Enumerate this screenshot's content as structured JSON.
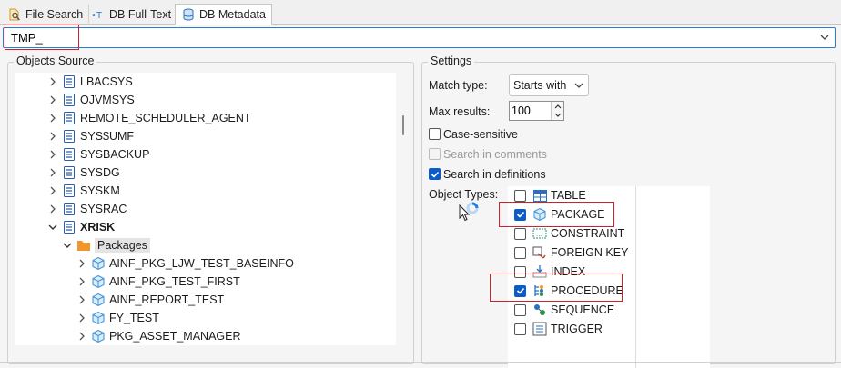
{
  "tabs": [
    {
      "label": "File Search",
      "icon": "file-search-icon"
    },
    {
      "label": "DB Full-Text",
      "icon": "fulltext-icon"
    },
    {
      "label": "DB Metadata",
      "icon": "database-icon",
      "active": true
    }
  ],
  "search": {
    "value": "TMP_"
  },
  "objects_source": {
    "title": "Objects Source",
    "items": [
      {
        "label": "LBACSYS",
        "expanded": false,
        "level": 1,
        "icon": "schema-icon"
      },
      {
        "label": "OJVMSYS",
        "expanded": false,
        "level": 1,
        "icon": "schema-icon"
      },
      {
        "label": "REMOTE_SCHEDULER_AGENT",
        "expanded": false,
        "level": 1,
        "icon": "schema-icon"
      },
      {
        "label": "SYS$UMF",
        "expanded": false,
        "level": 1,
        "icon": "schema-icon"
      },
      {
        "label": "SYSBACKUP",
        "expanded": false,
        "level": 1,
        "icon": "schema-icon"
      },
      {
        "label": "SYSDG",
        "expanded": false,
        "level": 1,
        "icon": "schema-icon"
      },
      {
        "label": "SYSKM",
        "expanded": false,
        "level": 1,
        "icon": "schema-icon"
      },
      {
        "label": "SYSRAC",
        "expanded": false,
        "level": 1,
        "icon": "schema-icon"
      },
      {
        "label": "XRISK",
        "expanded": true,
        "level": 1,
        "icon": "schema-icon",
        "bold": true
      },
      {
        "label": "Packages",
        "expanded": true,
        "level": 2,
        "icon": "folder-icon",
        "selected": true
      },
      {
        "label": "AINF_PKG_LJW_TEST_BASEINFO",
        "expanded": false,
        "level": 3,
        "icon": "package-icon"
      },
      {
        "label": "AINF_PKG_TEST_FIRST",
        "expanded": false,
        "level": 3,
        "icon": "package-icon"
      },
      {
        "label": "AINF_REPORT_TEST",
        "expanded": false,
        "level": 3,
        "icon": "package-icon"
      },
      {
        "label": "FY_TEST",
        "expanded": false,
        "level": 3,
        "icon": "package-icon"
      },
      {
        "label": "PKG_ASSET_MANAGER",
        "expanded": false,
        "level": 3,
        "icon": "package-icon"
      }
    ]
  },
  "settings": {
    "title": "Settings",
    "match_type_label": "Match type:",
    "match_type_value": "Starts with",
    "max_results_label": "Max results:",
    "max_results_value": "100",
    "case_sensitive": {
      "label": "Case-sensitive",
      "checked": false
    },
    "search_comments": {
      "label": "Search in comments",
      "checked": false,
      "disabled": true
    },
    "search_definitions": {
      "label": "Search in definitions",
      "checked": true
    },
    "object_types_label": "Object Types:",
    "object_types": [
      {
        "label": "TABLE",
        "checked": false,
        "icon": "table-icon"
      },
      {
        "label": "PACKAGE",
        "checked": true,
        "icon": "package-icon"
      },
      {
        "label": "CONSTRAINT",
        "checked": false,
        "icon": "constraint-icon"
      },
      {
        "label": "FOREIGN KEY",
        "checked": false,
        "icon": "foreign-key-icon"
      },
      {
        "label": "INDEX",
        "checked": false,
        "icon": "index-icon"
      },
      {
        "label": "PROCEDURE",
        "checked": true,
        "icon": "procedure-icon"
      },
      {
        "label": "SEQUENCE",
        "checked": false,
        "icon": "sequence-icon"
      },
      {
        "label": "TRIGGER",
        "checked": false,
        "icon": "trigger-icon"
      }
    ]
  },
  "colors": {
    "accent": "#0b5cc7",
    "highlight_box": "#d0202a",
    "folder": "#f0962a",
    "schema_icon": "#2a5fb0",
    "package_icon": "#3a8fd6"
  }
}
